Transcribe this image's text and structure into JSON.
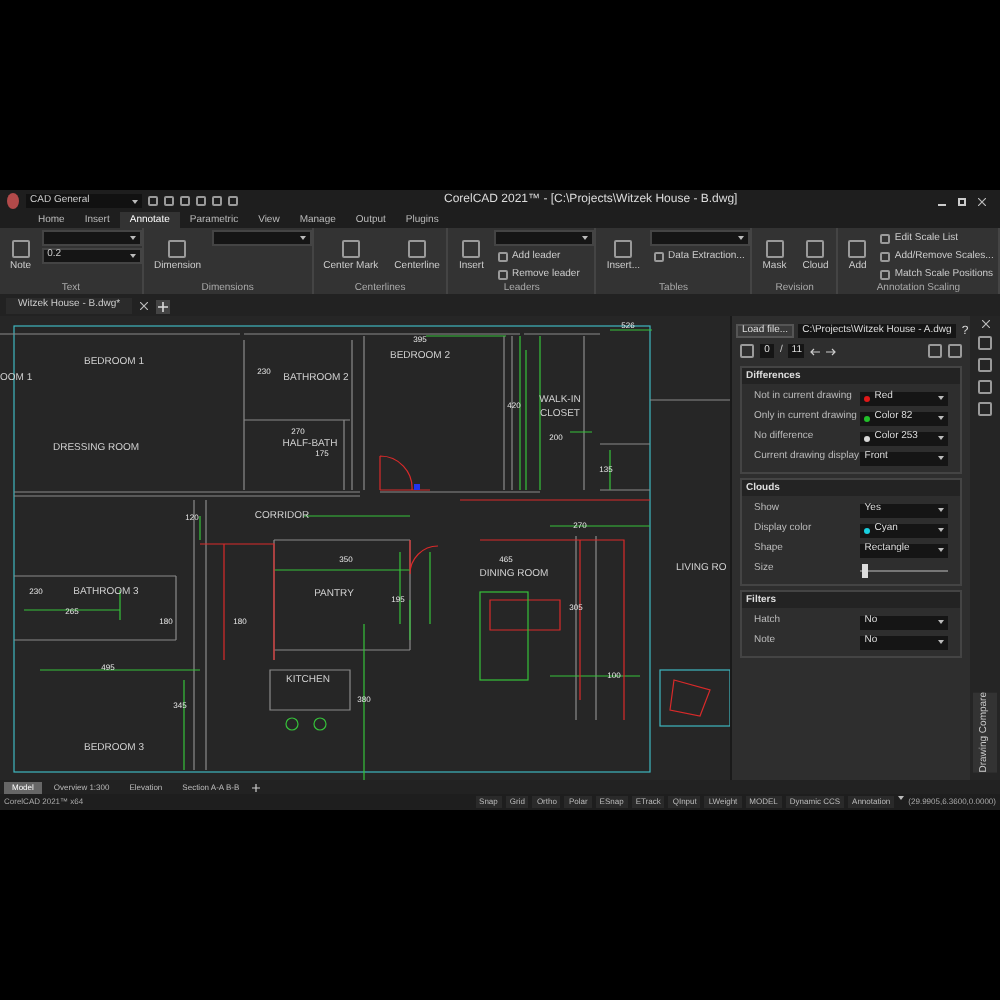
{
  "title_bar": {
    "workspace": "CAD General",
    "title": "CorelCAD 2021™ - [C:\\Projects\\Witzek House - B.dwg]"
  },
  "ribbon_tabs": [
    {
      "label": "Home",
      "selected": false
    },
    {
      "label": "Insert",
      "selected": false
    },
    {
      "label": "Annotate",
      "selected": true
    },
    {
      "label": "Parametric",
      "selected": false
    },
    {
      "label": "View",
      "selected": false
    },
    {
      "label": "Manage",
      "selected": false
    },
    {
      "label": "Output",
      "selected": false
    },
    {
      "label": "Plugins",
      "selected": false
    }
  ],
  "ribbon_groups": [
    {
      "label": "Text",
      "items": [
        {
          "kind": "large",
          "label": "Note"
        },
        {
          "kind": "field"
        },
        {
          "kind": "field",
          "label": "0.2"
        }
      ]
    },
    {
      "label": "Dimensions",
      "items": [
        {
          "kind": "large",
          "label": "Dimension"
        },
        {
          "kind": "field"
        }
      ]
    },
    {
      "label": "Centerlines",
      "items": [
        {
          "kind": "large",
          "label": "Center Mark"
        },
        {
          "kind": "large",
          "label": "Centerline"
        }
      ]
    },
    {
      "label": "Leaders",
      "items": [
        {
          "kind": "large",
          "label": "Insert"
        },
        {
          "kind": "field"
        },
        {
          "kind": "small",
          "label": "Add leader"
        },
        {
          "kind": "small",
          "label": "Remove leader"
        }
      ]
    },
    {
      "label": "Tables",
      "items": [
        {
          "kind": "large",
          "label": "Insert..."
        },
        {
          "kind": "field"
        },
        {
          "kind": "small",
          "label": "Data Extraction..."
        }
      ]
    },
    {
      "label": "Revision",
      "items": [
        {
          "kind": "large",
          "label": "Mask"
        },
        {
          "kind": "large",
          "label": "Cloud"
        }
      ]
    },
    {
      "label": "Annotation Scaling",
      "items": [
        {
          "kind": "large",
          "label": "Add"
        },
        {
          "kind": "small",
          "label": "Edit Scale List"
        },
        {
          "kind": "small",
          "label": "Add/Remove Scales..."
        },
        {
          "kind": "small",
          "label": "Match Scale Positions"
        }
      ]
    }
  ],
  "document_tab": "Witzek House - B.dwg*",
  "plan_labels": [
    {
      "text": "OOM 1",
      "kind": "room"
    },
    {
      "text": "BEDROOM 1",
      "kind": "room"
    },
    {
      "text": "BATHROOM 2",
      "kind": "room"
    },
    {
      "text": "BEDROOM 2",
      "kind": "room"
    },
    {
      "text": "WALK-IN",
      "kind": "room"
    },
    {
      "text": "CLOSET",
      "kind": "room"
    },
    {
      "text": "DRESSING ROOM",
      "kind": "room"
    },
    {
      "text": "HALF-BATH",
      "kind": "room"
    },
    {
      "text": "CORRIDOR",
      "kind": "room"
    },
    {
      "text": "DINING ROOM",
      "kind": "room"
    },
    {
      "text": "LIVING RO",
      "kind": "room"
    },
    {
      "text": "BATHROOM 3",
      "kind": "room"
    },
    {
      "text": "PANTRY",
      "kind": "room"
    },
    {
      "text": "KITCHEN",
      "kind": "room"
    },
    {
      "text": "BEDROOM 3",
      "kind": "room"
    },
    {
      "text": "526",
      "kind": "dimension"
    },
    {
      "text": "395",
      "kind": "dimension"
    },
    {
      "text": "230",
      "kind": "dimension"
    },
    {
      "text": "420",
      "kind": "dimension"
    },
    {
      "text": "270",
      "kind": "dimension"
    },
    {
      "text": "175",
      "kind": "dimension"
    },
    {
      "text": "200",
      "kind": "dimension"
    },
    {
      "text": "135",
      "kind": "dimension"
    },
    {
      "text": "120",
      "kind": "dimension"
    },
    {
      "text": "270",
      "kind": "dimension"
    },
    {
      "text": "350",
      "kind": "dimension"
    },
    {
      "text": "465",
      "kind": "dimension"
    },
    {
      "text": "230",
      "kind": "dimension"
    },
    {
      "text": "265",
      "kind": "dimension"
    },
    {
      "text": "180",
      "kind": "dimension"
    },
    {
      "text": "180",
      "kind": "dimension"
    },
    {
      "text": "195",
      "kind": "dimension"
    },
    {
      "text": "305",
      "kind": "dimension"
    },
    {
      "text": "495",
      "kind": "dimension"
    },
    {
      "text": "100",
      "kind": "dimension"
    },
    {
      "text": "345",
      "kind": "dimension"
    },
    {
      "text": "380",
      "kind": "dimension"
    }
  ],
  "compare_panel": {
    "load_button": "Load file...",
    "path": "C:\\Projects\\Witzek House - A.dwg",
    "help": "?",
    "page": "0",
    "separator": "/",
    "page_count": "11",
    "sections": [
      {
        "title": "Differences",
        "rows": [
          {
            "kind": "select",
            "label": "Not in current drawing",
            "value": "Red",
            "color": "#e01818"
          },
          {
            "kind": "select",
            "label": "Only in current drawing",
            "value": "Color 82",
            "color": "#22c02a"
          },
          {
            "kind": "select",
            "label": "No difference",
            "value": "Color 253",
            "color": "#d8d8d8"
          },
          {
            "kind": "select",
            "label": "Current drawing display",
            "value": "Front"
          }
        ]
      },
      {
        "title": "Clouds",
        "rows": [
          {
            "kind": "select",
            "label": "Show",
            "value": "Yes"
          },
          {
            "kind": "select",
            "label": "Display color",
            "value": "Cyan",
            "color": "#18d0e0"
          },
          {
            "kind": "select",
            "label": "Shape",
            "value": "Rectangle"
          },
          {
            "kind": "slider",
            "label": "Size",
            "level": 0.02
          }
        ]
      },
      {
        "title": "Filters",
        "rows": [
          {
            "kind": "select",
            "label": "Hatch",
            "value": "No"
          },
          {
            "kind": "select",
            "label": "Note",
            "value": "No"
          }
        ]
      }
    ]
  },
  "side_tab": "Drawing Compare",
  "layout_tabs": [
    {
      "label": "Model",
      "selected": true
    },
    {
      "label": "Overview 1:300",
      "selected": false
    },
    {
      "label": "Elevation",
      "selected": false
    },
    {
      "label": "Section A-A B-B",
      "selected": false
    }
  ],
  "status_bar": {
    "product": "CorelCAD 2021™ x64",
    "toggles": [
      "Snap",
      "Grid",
      "Ortho",
      "Polar",
      "ESnap",
      "ETrack",
      "QInput",
      "LWeight",
      "MODEL",
      "Dynamic CCS"
    ],
    "annotation": "Annotation",
    "coordinates": "(29.9905,6.3600,0.0000)"
  }
}
